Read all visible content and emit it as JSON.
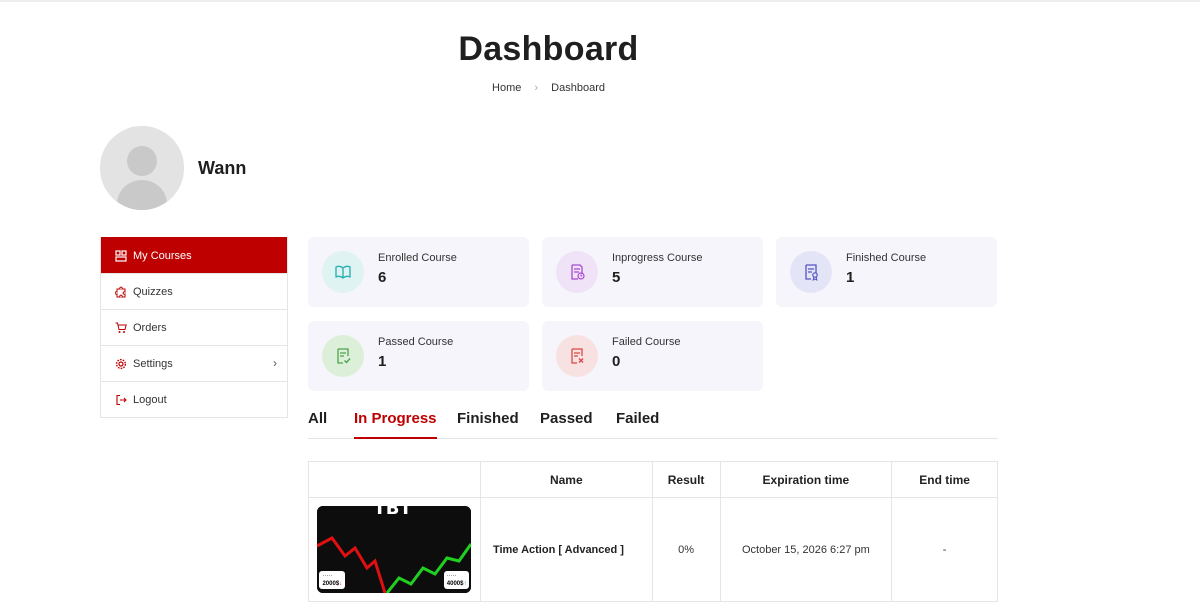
{
  "header": {
    "title": "Dashboard",
    "breadcrumb": [
      "Home",
      "Dashboard"
    ]
  },
  "profile": {
    "name": "Wann"
  },
  "sidebar": {
    "items": [
      {
        "label": "My Courses",
        "icon": "courses-icon",
        "active": true
      },
      {
        "label": "Quizzes",
        "icon": "puzzle-icon",
        "active": false
      },
      {
        "label": "Orders",
        "icon": "cart-icon",
        "active": false
      },
      {
        "label": "Settings",
        "icon": "gear-icon",
        "active": false,
        "has_submenu": true
      },
      {
        "label": "Logout",
        "icon": "logout-icon",
        "active": false
      }
    ]
  },
  "stats": [
    {
      "label": "Enrolled Course",
      "value": "6",
      "icon": "book-icon",
      "color": "#2bb3b1",
      "bg": "#dff3f3"
    },
    {
      "label": "Inprogress Course",
      "value": "5",
      "icon": "progress-doc-icon",
      "color": "#a64bd1",
      "bg": "#f0e2f7"
    },
    {
      "label": "Finished Course",
      "value": "1",
      "icon": "certificate-icon",
      "color": "#5454c4",
      "bg": "#e4e4f7"
    },
    {
      "label": "Passed Course",
      "value": "1",
      "icon": "passed-doc-icon",
      "color": "#4ea34e",
      "bg": "#dcefd9"
    },
    {
      "label": "Failed Course",
      "value": "0",
      "icon": "failed-doc-icon",
      "color": "#d84a4a",
      "bg": "#f8e1e1"
    }
  ],
  "tabs": [
    {
      "label": "All",
      "active": false
    },
    {
      "label": "In Progress",
      "active": true
    },
    {
      "label": "Finished",
      "active": false
    },
    {
      "label": "Passed",
      "active": false
    },
    {
      "label": "Failed",
      "active": false
    }
  ],
  "table": {
    "headers": [
      "",
      "Name",
      "Result",
      "Expiration time",
      "End time"
    ],
    "rows": [
      {
        "thumbnail": {
          "title": "TBT",
          "left_price": "2000$",
          "right_price": "4000$"
        },
        "name": "Time Action [ Advanced ]",
        "result": "0%",
        "expiration": "October 15, 2026 6:27 pm",
        "end_time": "-"
      }
    ]
  },
  "colors": {
    "accent": "#be0000",
    "card_bg": "#f6f5fb",
    "border": "#e5e5e5"
  }
}
